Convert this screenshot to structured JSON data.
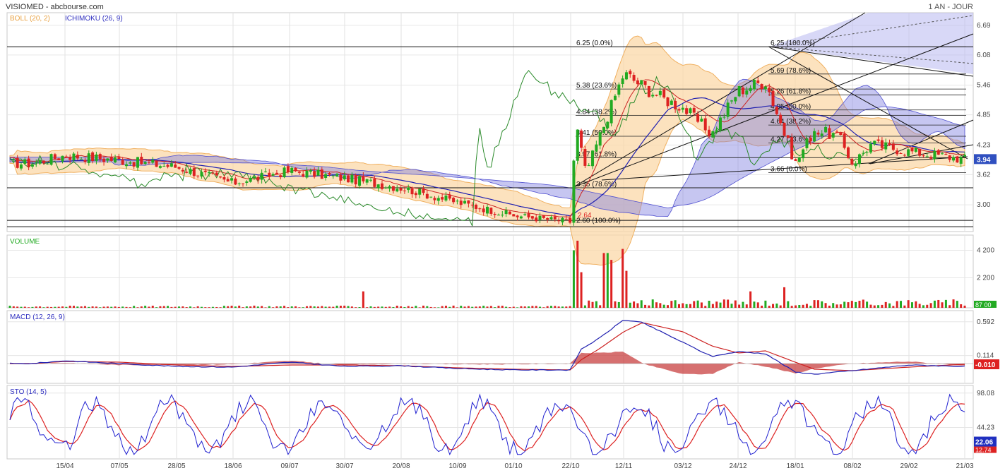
{
  "header": {
    "title": "VISIOMED - abcbourse.com",
    "period": "1 AN - JOUR"
  },
  "colors": {
    "boll": "#f0a040",
    "ichimoku_line": "#3030c0",
    "ichimoku_cloud": "#8080e0",
    "up": "#22aa22",
    "down": "#dd2222",
    "chikou": "#2a8a2a",
    "grid": "#d8d8d8",
    "last_price_bg": "#3050c0"
  },
  "chart_data": [
    {
      "id": "price",
      "type": "candlestick",
      "legend": [
        {
          "label": "BOLL (20, 2)",
          "color": "#e8a040"
        },
        {
          "label": "ICHIMOKU (26, 9)",
          "color": "#3030c0"
        }
      ],
      "ylim": [
        2.45,
        6.95
      ],
      "y_ticks": [
        "6.69",
        "6.08",
        "5.46",
        "4.85",
        "4.23",
        "3.62",
        "3.00"
      ],
      "last_price": "3.94",
      "fibonacci": [
        {
          "price": 6.25,
          "label": "6.25  (0.0%)"
        },
        {
          "price": 5.38,
          "label": "5.38  (23.6%)"
        },
        {
          "price": 4.84,
          "label": "4.84  (38.2%)"
        },
        {
          "price": 4.41,
          "label": "4.41  (50.0%)"
        },
        {
          "price": 3.97,
          "label": "3.97  (61.8%)"
        },
        {
          "price": 3.35,
          "label": "3.35  (78.6%)"
        },
        {
          "price": 2.6,
          "label": "2.60  (100.0%)"
        }
      ],
      "fibonacci_2": [
        {
          "price": 6.25,
          "label": "6.25  (100.0%)"
        },
        {
          "price": 5.69,
          "label": "5.69  (78.6%)"
        },
        {
          "price": 5.26,
          "label": "5.26  (61.8%)"
        },
        {
          "price": 4.95,
          "label": "4.95  (50.0%)"
        },
        {
          "price": 4.64,
          "label": "4.64  (38.2%)"
        },
        {
          "price": 4.27,
          "label": "4.27  (23.6%)"
        },
        {
          "price": 3.66,
          "label": "3.66  (0.0%)"
        }
      ],
      "annotation_low": "2.64",
      "horizontal_lines": [
        6.25,
        2.55,
        2.68,
        3.35
      ],
      "anchors": [
        {
          "date": "01/04",
          "close": 3.85
        },
        {
          "date": "15/04",
          "close": 4.02
        },
        {
          "date": "07/05",
          "close": 3.92
        },
        {
          "date": "28/05",
          "close": 3.78
        },
        {
          "date": "18/06",
          "close": 3.45
        },
        {
          "date": "09/07",
          "close": 3.7
        },
        {
          "date": "30/07",
          "close": 3.55
        },
        {
          "date": "20/08",
          "close": 3.35
        },
        {
          "date": "10/09",
          "close": 3.05
        },
        {
          "date": "01/10",
          "close": 2.78
        },
        {
          "date": "22/10",
          "close": 2.65
        },
        {
          "date": "24/10",
          "close": 4.7
        },
        {
          "date": "28/10",
          "close": 3.65
        },
        {
          "date": "12/11",
          "close": 5.7
        },
        {
          "date": "26/11",
          "close": 5.2
        },
        {
          "date": "03/12",
          "close": 5.0
        },
        {
          "date": "14/12",
          "close": 4.45
        },
        {
          "date": "24/12",
          "close": 5.35
        },
        {
          "date": "05/01",
          "close": 5.55
        },
        {
          "date": "18/01",
          "close": 3.85
        },
        {
          "date": "25/01",
          "close": 4.55
        },
        {
          "date": "03/02",
          "close": 4.4
        },
        {
          "date": "08/02",
          "close": 3.85
        },
        {
          "date": "15/02",
          "close": 4.25
        },
        {
          "date": "29/02",
          "close": 4.1
        },
        {
          "date": "21/03",
          "close": 3.94
        }
      ]
    },
    {
      "id": "volume",
      "type": "bar",
      "label": "VOLUME",
      "ylim": [
        0,
        5000
      ],
      "y_ticks": [
        "4 200",
        "2 200"
      ],
      "last_value": "87 00",
      "spikes": [
        {
          "date": "24/10",
          "value": 4200
        },
        {
          "date": "25/10",
          "value": 4900
        },
        {
          "date": "26/10",
          "value": 2600
        },
        {
          "date": "05/11",
          "value": 4000
        },
        {
          "date": "07/11",
          "value": 3500
        },
        {
          "date": "12/11",
          "value": 4300
        },
        {
          "date": "13/11",
          "value": 2700
        },
        {
          "date": "29/12",
          "value": 1200
        },
        {
          "date": "13/01",
          "value": 1500
        },
        {
          "date": "06/08",
          "value": 1200
        }
      ]
    },
    {
      "id": "macd",
      "type": "line",
      "label": "MACD (12, 26, 9)",
      "ylim": [
        -0.28,
        0.75
      ],
      "y_ticks": [
        "0.592",
        "0.114"
      ],
      "last_value": "-0.010",
      "anchors": [
        {
          "date": "01/04",
          "macd": 0.0,
          "signal": 0.0
        },
        {
          "date": "15/04",
          "macd": 0.04,
          "signal": 0.03
        },
        {
          "date": "07/05",
          "macd": 0.0,
          "signal": 0.02
        },
        {
          "date": "28/05",
          "macd": -0.04,
          "signal": -0.02
        },
        {
          "date": "18/06",
          "macd": -0.05,
          "signal": -0.04
        },
        {
          "date": "09/07",
          "macd": 0.02,
          "signal": -0.02
        },
        {
          "date": "30/07",
          "macd": -0.04,
          "signal": -0.02
        },
        {
          "date": "20/08",
          "macd": -0.03,
          "signal": -0.03
        },
        {
          "date": "10/09",
          "macd": -0.07,
          "signal": -0.06
        },
        {
          "date": "01/10",
          "macd": -0.09,
          "signal": -0.08
        },
        {
          "date": "22/10",
          "macd": -0.09,
          "signal": -0.09
        },
        {
          "date": "26/10",
          "macd": 0.2,
          "signal": 0.05
        },
        {
          "date": "02/11",
          "macd": 0.35,
          "signal": 0.2
        },
        {
          "date": "12/11",
          "macd": 0.62,
          "signal": 0.45
        },
        {
          "date": "19/11",
          "macd": 0.58,
          "signal": 0.58
        },
        {
          "date": "03/12",
          "macd": 0.3,
          "signal": 0.45
        },
        {
          "date": "14/12",
          "macd": 0.1,
          "signal": 0.25
        },
        {
          "date": "24/12",
          "macd": 0.17,
          "signal": 0.15
        },
        {
          "date": "05/01",
          "macd": 0.14,
          "signal": 0.18
        },
        {
          "date": "18/01",
          "macd": -0.12,
          "signal": 0.02
        },
        {
          "date": "25/01",
          "macd": -0.15,
          "signal": -0.08
        },
        {
          "date": "08/02",
          "macd": -0.1,
          "signal": -0.1
        },
        {
          "date": "29/02",
          "macd": -0.02,
          "signal": -0.05
        },
        {
          "date": "21/03",
          "macd": -0.04,
          "signal": -0.01
        }
      ]
    },
    {
      "id": "sto",
      "type": "line",
      "label": "STO (14, 5)",
      "ylim": [
        -5,
        110
      ],
      "y_ticks": [
        "98.08",
        "44.23"
      ],
      "last_values": [
        "22.06",
        "12.74"
      ]
    }
  ],
  "x_axis": {
    "labels": [
      "15/04",
      "07/05",
      "28/05",
      "18/06",
      "09/07",
      "30/07",
      "20/08",
      "10/09",
      "01/10",
      "22/10",
      "12/11",
      "03/12",
      "24/12",
      "18/01",
      "08/02",
      "29/02",
      "21/03"
    ]
  }
}
